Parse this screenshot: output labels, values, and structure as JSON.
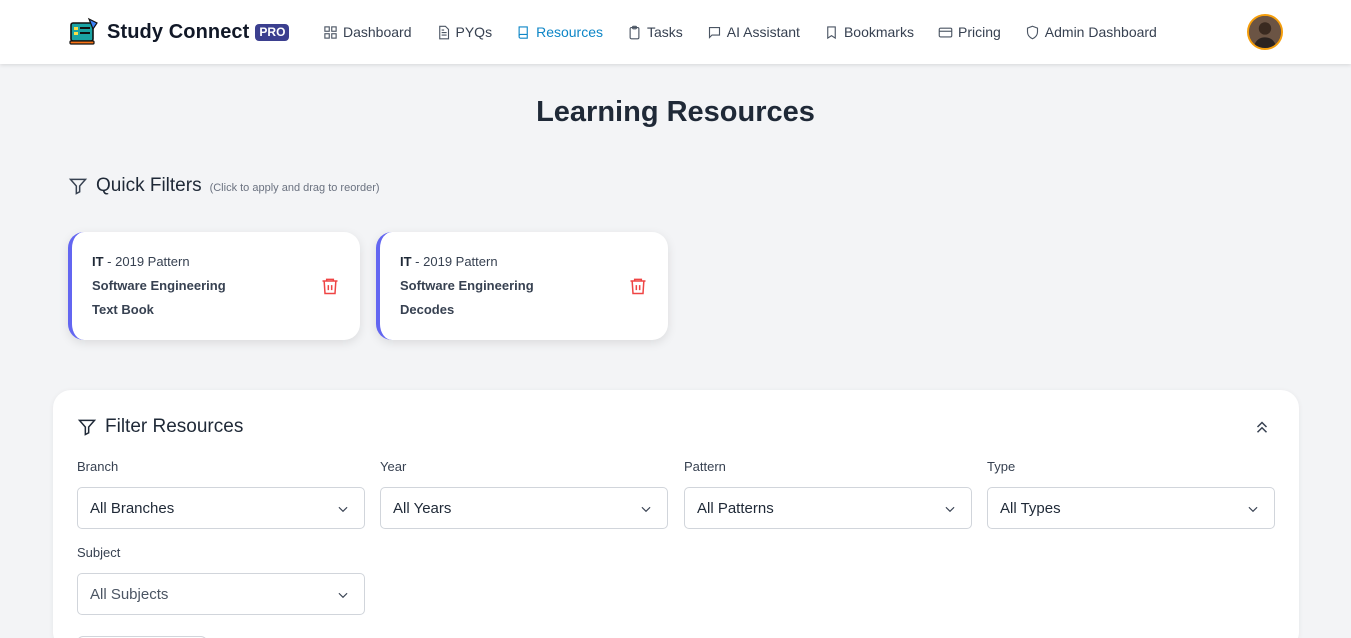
{
  "brand": {
    "name": "Study Connect",
    "badge": "PRO"
  },
  "nav": [
    {
      "label": "Dashboard",
      "icon": "grid-icon",
      "active": false
    },
    {
      "label": "PYQs",
      "icon": "document-icon",
      "active": false
    },
    {
      "label": "Resources",
      "icon": "book-icon",
      "active": true
    },
    {
      "label": "Tasks",
      "icon": "clipboard-icon",
      "active": false
    },
    {
      "label": "AI Assistant",
      "icon": "chat-icon",
      "active": false
    },
    {
      "label": "Bookmarks",
      "icon": "bookmark-icon",
      "active": false
    },
    {
      "label": "Pricing",
      "icon": "credit-card-icon",
      "active": false
    },
    {
      "label": "Admin Dashboard",
      "icon": "shield-icon",
      "active": false
    }
  ],
  "page": {
    "title": "Learning Resources"
  },
  "quick_filters": {
    "title": "Quick Filters",
    "hint": "(Click to apply and drag to reorder)",
    "items": [
      {
        "branch": "IT",
        "pattern": "2019 Pattern",
        "subject": "Software Engineering",
        "type": "Text Book"
      },
      {
        "branch": "IT",
        "pattern": "2019 Pattern",
        "subject": "Software Engineering",
        "type": "Decodes"
      }
    ]
  },
  "filter_panel": {
    "title": "Filter Resources",
    "fields": {
      "branch": {
        "label": "Branch",
        "value": "All Branches"
      },
      "year": {
        "label": "Year",
        "value": "All Years"
      },
      "pattern": {
        "label": "Pattern",
        "value": "All Patterns"
      },
      "type": {
        "label": "Type",
        "value": "All Types"
      },
      "subject": {
        "label": "Subject",
        "value": "All Subjects"
      }
    }
  },
  "colors": {
    "accent": "#0e86c7",
    "card_border": "#6366f1",
    "delete": "#ef4444",
    "badge": "#3b3f8f",
    "avatar_ring": "#f59e0b"
  }
}
